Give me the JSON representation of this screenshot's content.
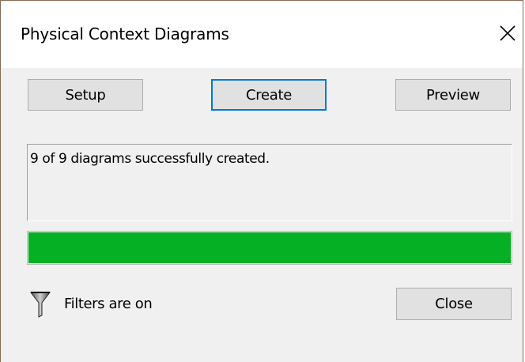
{
  "window": {
    "title": "Physical Context Diagrams"
  },
  "toolbar": {
    "setup_label": "Setup",
    "create_label": "Create",
    "preview_label": "Preview"
  },
  "status": {
    "message": "9 of 9 diagrams successfully created."
  },
  "progress": {
    "completed": 9,
    "total": 9,
    "fraction": 1.0,
    "color": "#06b025"
  },
  "footer": {
    "filter_icon": "funnel-icon",
    "filter_label": "Filters are on",
    "close_label": "Close"
  },
  "colors": {
    "focus_border": "#0078d7",
    "dialog_background": "#f0f0f0",
    "button_face": "#e1e1e1"
  }
}
